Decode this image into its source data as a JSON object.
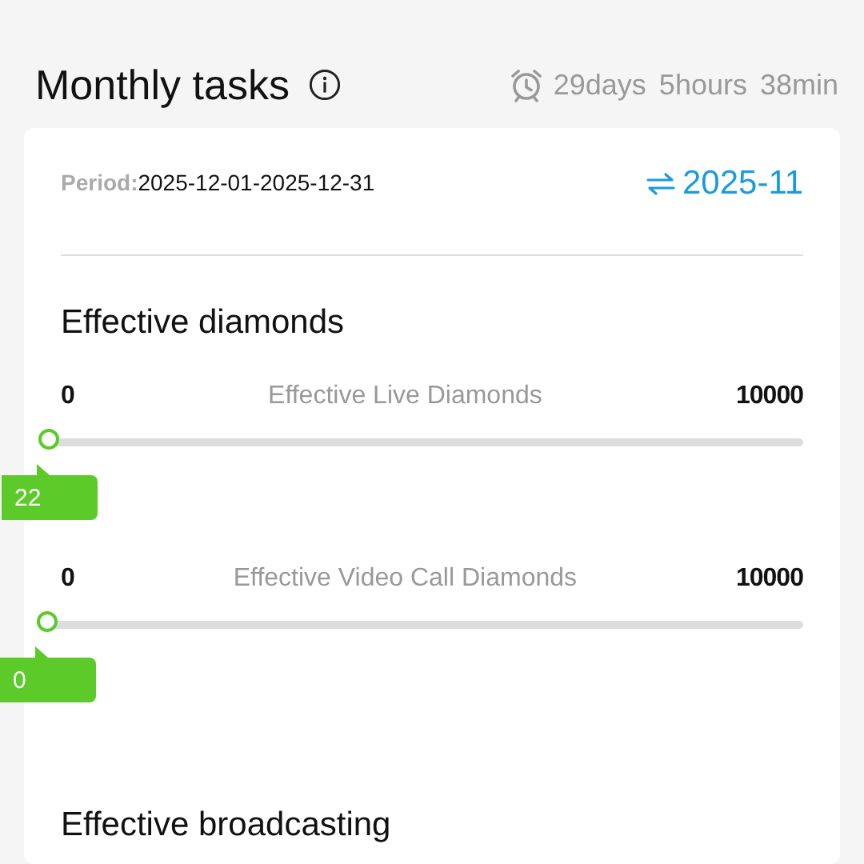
{
  "header": {
    "title": "Monthly tasks",
    "countdown": "29days 5hours 38min"
  },
  "period": {
    "label": "Period:",
    "value": "2025-12-01-2025-12-31",
    "switch_month": "2025-11"
  },
  "sections": [
    {
      "title": "Effective diamonds",
      "sliders": [
        {
          "min": "0",
          "label": "Effective Live Diamonds",
          "max": "10000",
          "level": 0.0022,
          "value": "22"
        },
        {
          "min": "0",
          "label": "Effective Video Call Diamonds",
          "max": "10000",
          "level": 0,
          "value": "0"
        }
      ]
    },
    {
      "title": "Effective broadcasting"
    }
  ]
}
